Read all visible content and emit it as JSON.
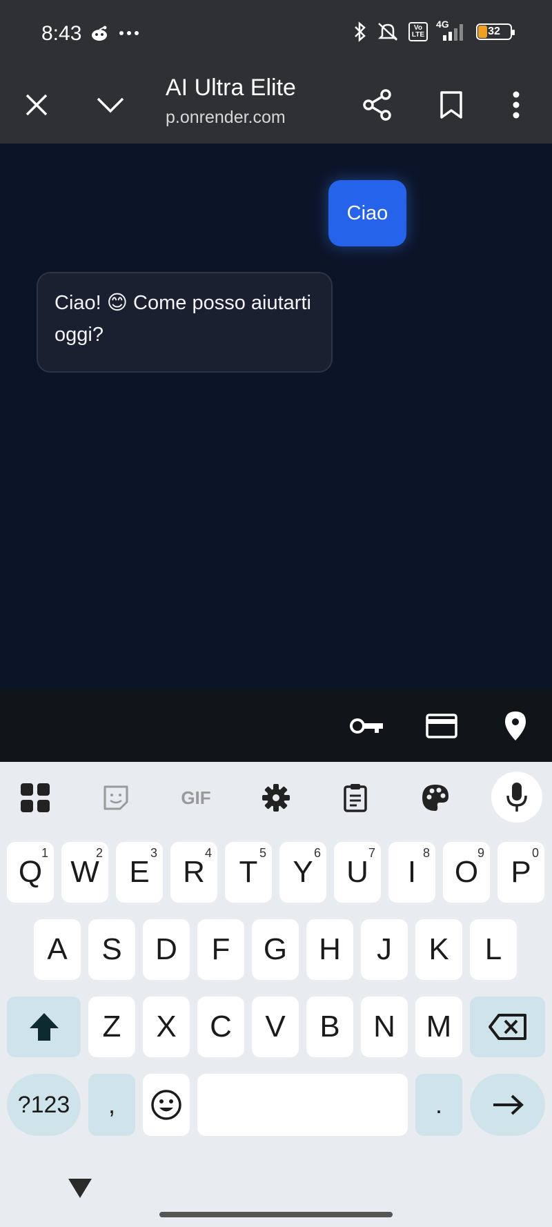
{
  "status_bar": {
    "time": "8:43",
    "battery_level": "32",
    "network": "4G",
    "volte_top": "Vo",
    "volte_bottom": "LTE"
  },
  "browser": {
    "title": "AI Ultra Elite",
    "url": "p.onrender.com"
  },
  "chat": {
    "messages": [
      {
        "role": "user",
        "text": "Ciao"
      },
      {
        "role": "assistant",
        "text": "Ciao! 😊 Come posso aiutarti oggi?"
      }
    ]
  },
  "keyboard": {
    "row1": [
      {
        "label": "Q",
        "hint": "1"
      },
      {
        "label": "W",
        "hint": "2"
      },
      {
        "label": "E",
        "hint": "3"
      },
      {
        "label": "R",
        "hint": "4"
      },
      {
        "label": "T",
        "hint": "5"
      },
      {
        "label": "Y",
        "hint": "6"
      },
      {
        "label": "U",
        "hint": "7"
      },
      {
        "label": "I",
        "hint": "8"
      },
      {
        "label": "O",
        "hint": "9"
      },
      {
        "label": "P",
        "hint": "0"
      }
    ],
    "row2": [
      "A",
      "S",
      "D",
      "F",
      "G",
      "H",
      "J",
      "K",
      "L"
    ],
    "row3": [
      "Z",
      "X",
      "C",
      "V",
      "B",
      "N",
      "M"
    ],
    "symbols_label": "?123",
    "comma_label": ",",
    "period_label": ".",
    "gif_label": "GIF"
  },
  "colors": {
    "accent": "#2563eb",
    "chat_bg": "#0c1428",
    "bot_bubble": "#1a2030",
    "browser_bar": "#2f3033",
    "keyboard_bg": "#e8ecf0",
    "key_special": "#cfe4ea"
  }
}
